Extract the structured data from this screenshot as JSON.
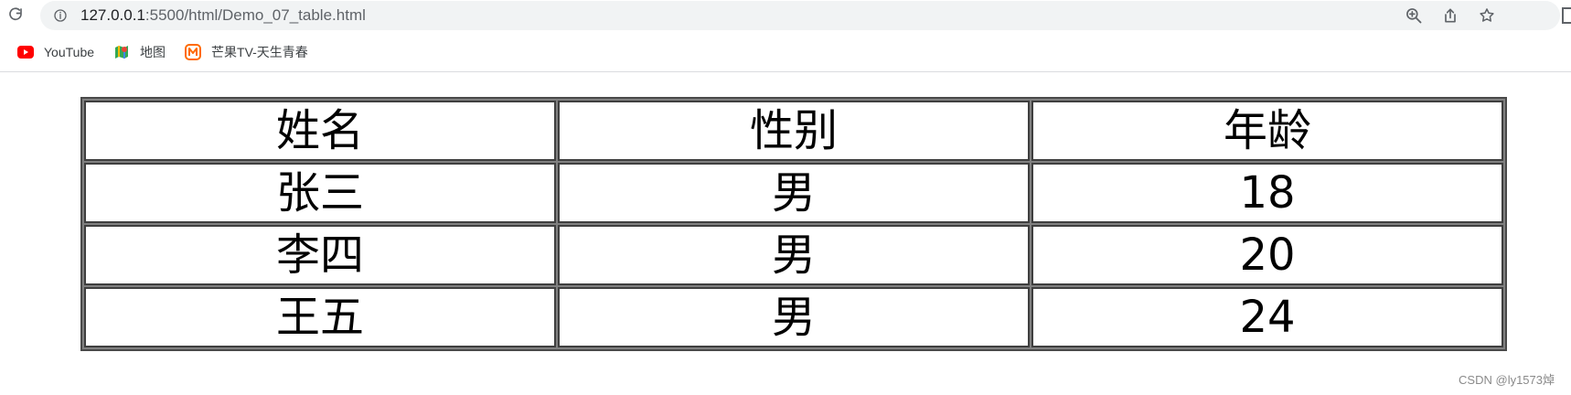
{
  "browser": {
    "url_host": "127.0.0.1",
    "url_path": ":5500/html/Demo_07_table.html",
    "icons": {
      "reload": "reload-icon",
      "info": "info-icon",
      "zoom": "zoom-icon",
      "share": "share-icon",
      "bookmark_star": "star-icon",
      "edge": "side-panel-icon"
    }
  },
  "bookmarks": [
    {
      "label": "YouTube",
      "icon": "youtube-icon",
      "color": "#ff0000"
    },
    {
      "label": "地图",
      "icon": "maps-icon",
      "color": "#34a853"
    },
    {
      "label": "芒果TV-天生青春",
      "icon": "mango-tv-icon",
      "color": "#ff6a00"
    }
  ],
  "table": {
    "headers": [
      "姓名",
      "性别",
      "年龄"
    ],
    "rows": [
      [
        "张三",
        "男",
        "18"
      ],
      [
        "李四",
        "男",
        "20"
      ],
      [
        "王五",
        "男",
        "24"
      ]
    ]
  },
  "watermark": "CSDN @ly1573焯"
}
